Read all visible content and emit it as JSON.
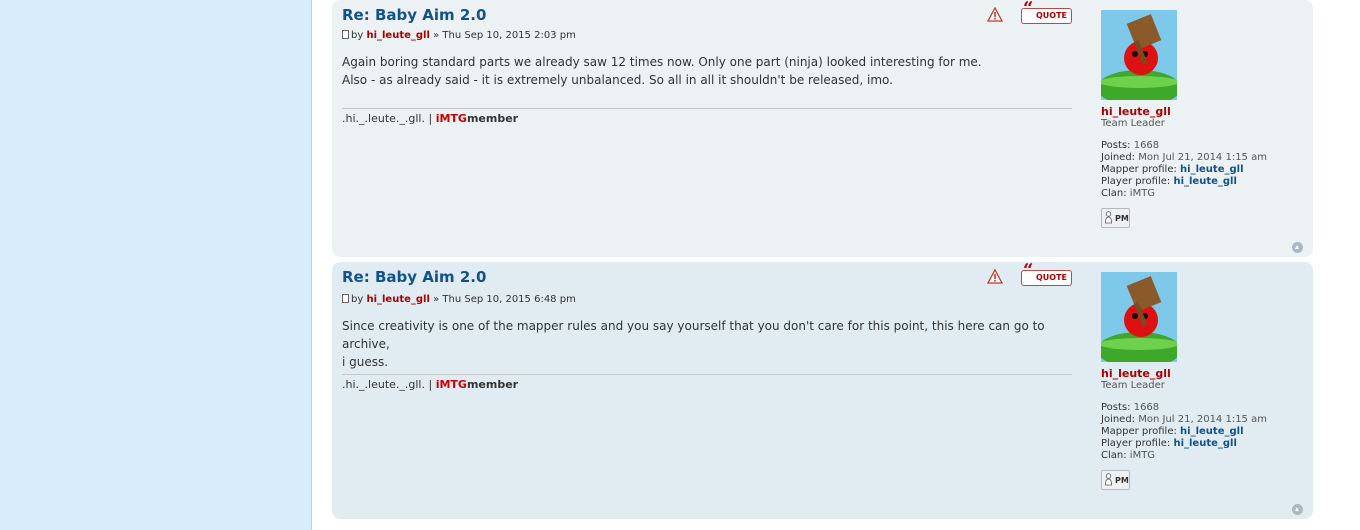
{
  "posts": [
    {
      "title": "Re: Baby Aim 2.0",
      "by": "by",
      "author": "hi_leute_gll",
      "date": "» Thu Sep 10, 2015 2:03 pm",
      "body_line1": "Again boring standard parts we already saw 12 times now. Only one part (ninja) looked interesting for me.",
      "body_line2": "Also - as already said - it is extremely unbalanced. So all in all it shouldn't be released, imo.",
      "sig_prefix": ".hi._.leute._.gll. |",
      "sig_red": "iMTG",
      "sig_bold": "member",
      "quote_label": "QUOTE",
      "profile": {
        "username": "hi_leute_gll",
        "rank": "Team Leader",
        "posts_label": "Posts:",
        "posts": "1668",
        "joined_label": "Joined:",
        "joined": "Mon Jul 21, 2014 1:15 am",
        "mapper_label": "Mapper profile:",
        "mapper": "hi_leute_gll",
        "player_label": "Player profile:",
        "player": "hi_leute_gll",
        "clan_label": "Clan:",
        "clan": "iMTG",
        "pm_label": "PM"
      }
    },
    {
      "title": "Re: Baby Aim 2.0",
      "by": "by",
      "author": "hi_leute_gll",
      "date": "» Thu Sep 10, 2015 6:48 pm",
      "body_line1": "Since creativity is one of the mapper rules and you say yourself that you don't care for this point, this here can go to archive,",
      "body_line2": "i guess.",
      "sig_prefix": ".hi._.leute._.gll. |",
      "sig_red": "iMTG",
      "sig_bold": "member",
      "quote_label": "QUOTE",
      "profile": {
        "username": "hi_leute_gll",
        "rank": "Team Leader",
        "posts_label": "Posts:",
        "posts": "1668",
        "joined_label": "Joined:",
        "joined": "Mon Jul 21, 2014 1:15 am",
        "mapper_label": "Mapper profile:",
        "mapper": "hi_leute_gll",
        "player_label": "Player profile:",
        "player": "hi_leute_gll",
        "clan_label": "Clan:",
        "clan": "iMTG",
        "pm_label": "PM"
      }
    }
  ],
  "icons": {
    "report": "report-icon",
    "quote": "quote-icon",
    "pm": "pm-icon",
    "top": "back-to-top-icon"
  },
  "colors": {
    "sidebar_bg": "#d8ecfb",
    "post_bg1": "#ecf1f3",
    "post_bg2": "#e1ebf2",
    "title": "#105289",
    "author_red": "#aa0000"
  }
}
